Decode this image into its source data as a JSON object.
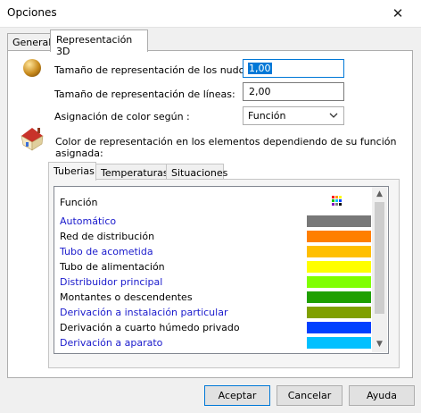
{
  "window": {
    "title": "Opciones",
    "close_glyph": "✕"
  },
  "tabs": [
    "General",
    "Representación 3D"
  ],
  "fields": {
    "nodes_label": "Tamaño de representación de los nudos:",
    "nodes_value": "1,00",
    "lines_label": "Tamaño de representación de líneas:",
    "lines_value": "2,00",
    "color_label": "Asignación de color según :",
    "color_value": "Función"
  },
  "description": "Color de representación en los elementos dependiendo de su función asignada:",
  "subtabs": [
    "Tuberias",
    "Temperaturas",
    "Situaciones"
  ],
  "list": {
    "header": "Función",
    "items": [
      {
        "name": "Automático",
        "color": "#787878",
        "text_color": "#1a1acc"
      },
      {
        "name": "Red de distribución",
        "color": "#ff7f00",
        "text_color": "#000000"
      },
      {
        "name": "Tubo de acometida",
        "color": "#ffbf00",
        "text_color": "#1a1acc"
      },
      {
        "name": "Tubo de alimentación",
        "color": "#ffff00",
        "text_color": "#000000"
      },
      {
        "name": "Distribuidor principal",
        "color": "#80ff00",
        "text_color": "#1a1acc"
      },
      {
        "name": "Montantes o descendentes",
        "color": "#20a000",
        "text_color": "#000000"
      },
      {
        "name": "Derivación a instalación particular",
        "color": "#80a000",
        "text_color": "#1a1acc"
      },
      {
        "name": "Derivación a cuarto húmedo privado",
        "color": "#0040ff",
        "text_color": "#000000"
      },
      {
        "name": "Derivación a aparato",
        "color": "#00c0ff",
        "text_color": "#1a1acc"
      }
    ]
  },
  "buttons": {
    "accept": "Aceptar",
    "cancel": "Cancelar",
    "help": "Ayuda"
  }
}
